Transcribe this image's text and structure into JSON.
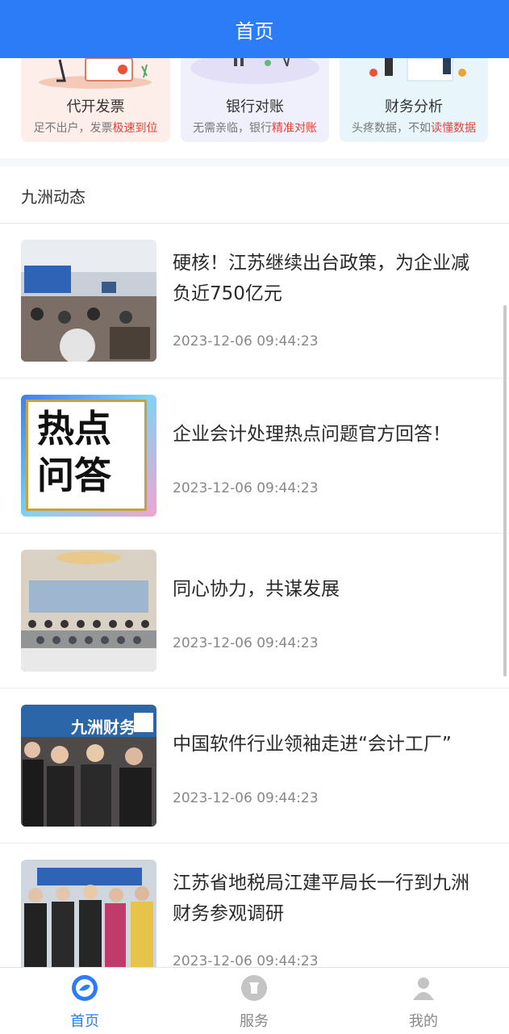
{
  "header": {
    "title": "首页"
  },
  "services": [
    {
      "title": "代开发票",
      "desc_plain": "足不出户，发票",
      "desc_highlight": "极速到位"
    },
    {
      "title": "银行对账",
      "desc_plain": "无需亲临，银行",
      "desc_highlight": "精准对账"
    },
    {
      "title": "财务分析",
      "desc_plain": "头疼数据，不如",
      "desc_highlight": "读懂数据"
    }
  ],
  "news_section": {
    "title": "九洲动态"
  },
  "news": [
    {
      "title": "硬核！江苏继续出台政策，为企业减负近750亿元",
      "time": "2023-12-06 09:44:23",
      "thumb_text": ""
    },
    {
      "title": "企业会计处理热点问题官方回答！",
      "time": "2023-12-06 09:44:23",
      "thumb_line1": "热点",
      "thumb_line2": "问答"
    },
    {
      "title": "同心协力，共谋发展",
      "time": "2023-12-06 09:44:23"
    },
    {
      "title": "中国软件行业领袖走进“会计工厂”",
      "time": "2023-12-06 09:44:23",
      "thumb_text": "九洲财务"
    },
    {
      "title": "江苏省地税局江建平局长一行到九洲财务参观调研",
      "time": "2023-12-06 09:44:23"
    }
  ],
  "tabbar": [
    {
      "label": "首页",
      "icon": "home-icon",
      "active": true
    },
    {
      "label": "服务",
      "icon": "service-icon",
      "active": false
    },
    {
      "label": "我的",
      "icon": "user-icon",
      "active": false
    }
  ],
  "colors": {
    "primary": "#2b7cf6",
    "highlight": "#e6423a"
  }
}
